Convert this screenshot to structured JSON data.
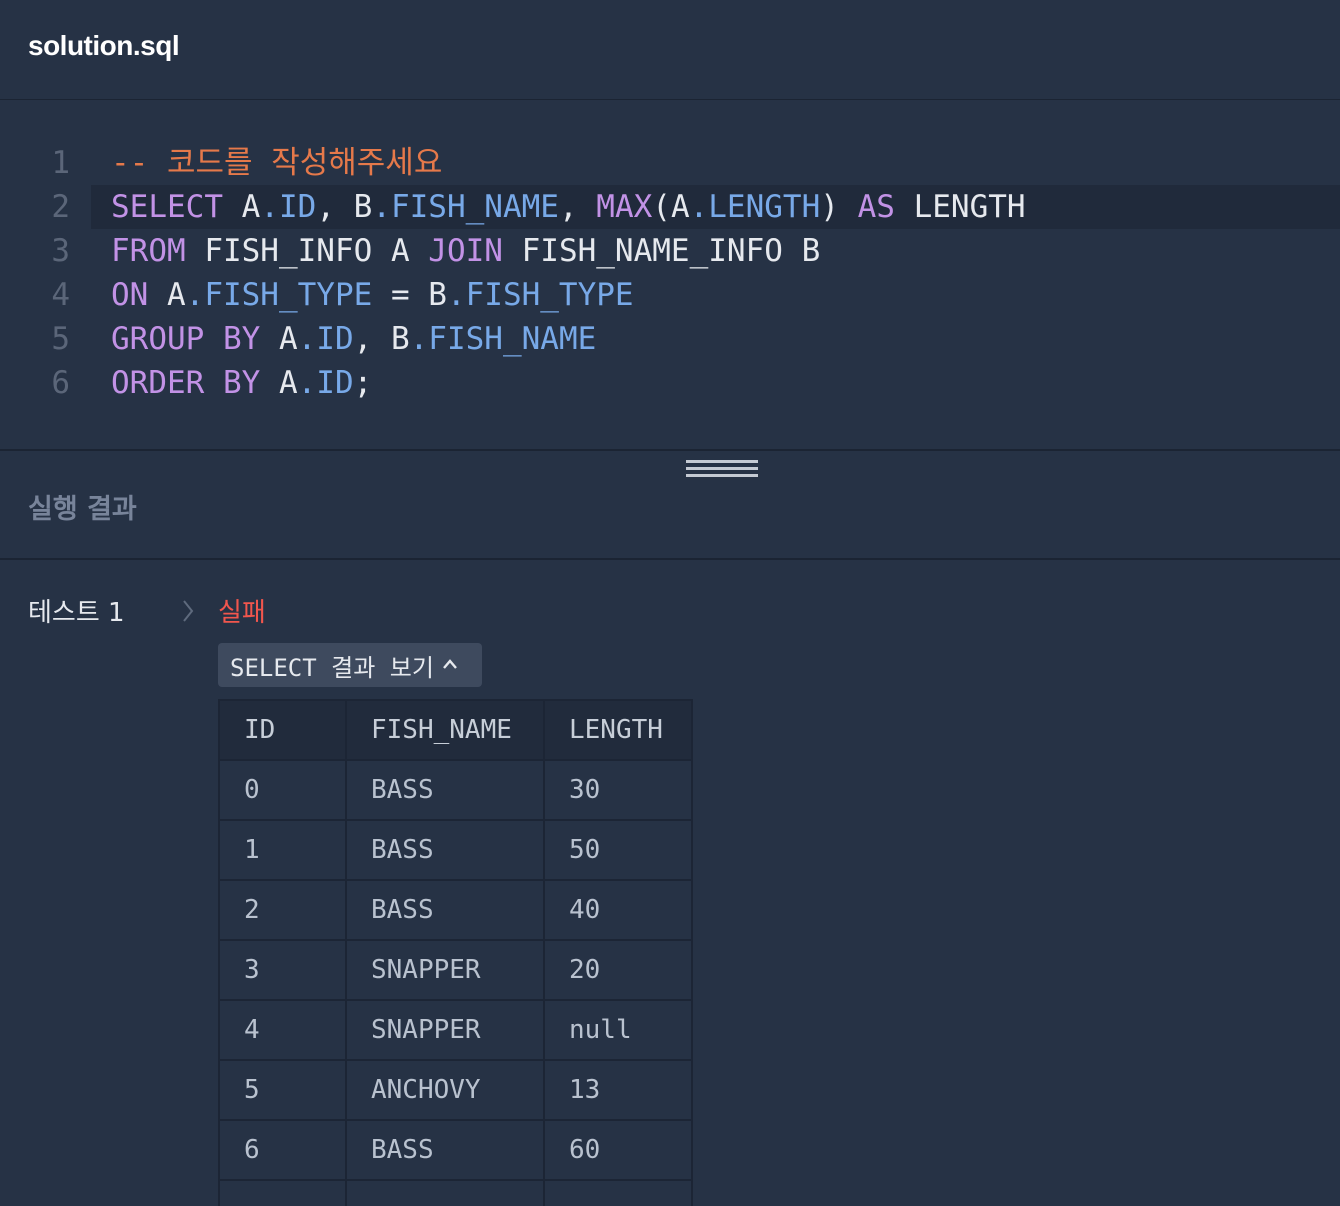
{
  "header": {
    "filename": "solution.sql"
  },
  "editor": {
    "lines": [
      {
        "num": "1",
        "tokens": [
          {
            "t": "-- 코드를 작성해주세요",
            "c": "comment"
          }
        ]
      },
      {
        "num": "2",
        "active": true,
        "tokens": [
          {
            "t": "SELECT",
            "c": "kw"
          },
          {
            "t": " A",
            "c": "plain"
          },
          {
            "t": ".ID",
            "c": "field"
          },
          {
            "t": ", B",
            "c": "plain"
          },
          {
            "t": ".FISH_NAME",
            "c": "field"
          },
          {
            "t": ", ",
            "c": "plain"
          },
          {
            "t": "MAX",
            "c": "kw"
          },
          {
            "t": "(A",
            "c": "plain"
          },
          {
            "t": ".LENGTH",
            "c": "field"
          },
          {
            "t": ") ",
            "c": "plain"
          },
          {
            "t": "AS",
            "c": "kw"
          },
          {
            "t": " LENGTH",
            "c": "plain"
          }
        ]
      },
      {
        "num": "3",
        "tokens": [
          {
            "t": "FROM",
            "c": "kw"
          },
          {
            "t": " FISH_INFO A ",
            "c": "plain"
          },
          {
            "t": "JOIN",
            "c": "kw"
          },
          {
            "t": " FISH_NAME_INFO B",
            "c": "plain"
          }
        ]
      },
      {
        "num": "4",
        "tokens": [
          {
            "t": "ON",
            "c": "kw"
          },
          {
            "t": " A",
            "c": "plain"
          },
          {
            "t": ".FISH_TYPE",
            "c": "field"
          },
          {
            "t": " = B",
            "c": "plain"
          },
          {
            "t": ".FISH_TYPE",
            "c": "field"
          }
        ]
      },
      {
        "num": "5",
        "tokens": [
          {
            "t": "GROUP BY",
            "c": "kw"
          },
          {
            "t": " A",
            "c": "plain"
          },
          {
            "t": ".ID",
            "c": "field"
          },
          {
            "t": ", B",
            "c": "plain"
          },
          {
            "t": ".FISH_NAME",
            "c": "field"
          }
        ]
      },
      {
        "num": "6",
        "tokens": [
          {
            "t": "ORDER BY",
            "c": "kw"
          },
          {
            "t": " A",
            "c": "plain"
          },
          {
            "t": ".ID",
            "c": "field"
          },
          {
            "t": ";",
            "c": "plain"
          }
        ]
      }
    ]
  },
  "results": {
    "title": "실행 결과",
    "test_label": "테스트 1",
    "status": "실패",
    "toggle_label": "SELECT 결과 보기",
    "table": {
      "columns": [
        "ID",
        "FISH_NAME",
        "LENGTH"
      ],
      "rows": [
        [
          "0",
          "BASS",
          "30"
        ],
        [
          "1",
          "BASS",
          "50"
        ],
        [
          "2",
          "BASS",
          "40"
        ],
        [
          "3",
          "SNAPPER",
          "20"
        ],
        [
          "4",
          "SNAPPER",
          "null"
        ],
        [
          "5",
          "ANCHOVY",
          "13"
        ],
        [
          "6",
          "BASS",
          "60"
        ],
        [
          "",
          "",
          ""
        ]
      ]
    }
  },
  "icons": {
    "chevron": "chevron-right-icon",
    "caret": "chevron-up-icon",
    "handle": "drag-handle-icon"
  }
}
